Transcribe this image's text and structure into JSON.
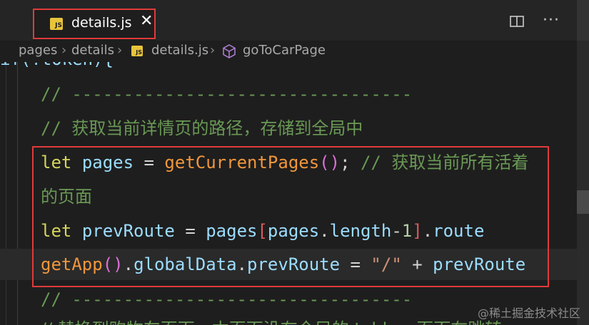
{
  "tab": {
    "icon_text": "JS",
    "filename": "details.js",
    "close_glyph": "✕"
  },
  "toolbar": {
    "more_glyph": "···"
  },
  "breadcrumb": {
    "items": [
      "pages",
      "details",
      "details.js",
      "goToCarPage"
    ],
    "separator": "›",
    "icon_text": "JS"
  },
  "code": {
    "partial_top": "if(!token){",
    "line1": "// ---------------------------------",
    "line2_prefix": "// ",
    "line2_text": "获取当前详情页的路径，存储到全局中",
    "line3": {
      "kw": "let",
      "var": "pages",
      "op": "=",
      "fn": "getCurrentPages",
      "semi": ";",
      "comment_prefix": "// ",
      "comment_text": "获取当前所有活着"
    },
    "line3_wrap": "的页面",
    "line4": {
      "kw": "let",
      "var": "prevRoute",
      "op": "=",
      "obj": "pages",
      "inner_obj": "pages",
      "prop": "length",
      "minus": "-",
      "num": "1",
      "route": "route"
    },
    "line5": {
      "fn": "getApp",
      "prop1": "globalData",
      "prop2": "prevRoute",
      "op": "=",
      "str": "\"/\"",
      "plus": "+",
      "var": "prevRoute"
    },
    "line6": "// ---------------------------------",
    "line7_partial": "// 替换到购物车页面，本页面没有全局的 tabbar 页面在跳转"
  },
  "watermark": "@稀土掘金技术社区",
  "colors": {
    "highlight_border": "#e03a3a",
    "comment": "#6a9955",
    "keyword": "#d4d45c",
    "function": "#f0963c",
    "variable": "#9cdcfe"
  }
}
